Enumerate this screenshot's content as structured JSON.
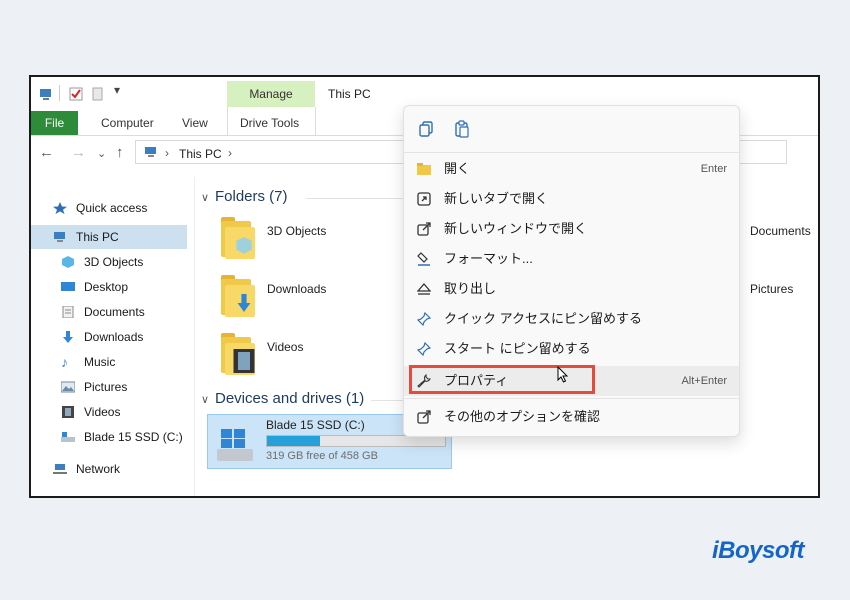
{
  "ribbon": {
    "file_tab": "File",
    "tabs": [
      "Computer",
      "View"
    ],
    "manage_label": "Manage",
    "drive_tools": "Drive Tools",
    "window_title": "This PC"
  },
  "address": {
    "path": "This PC",
    "separator": "›"
  },
  "sidebar": {
    "items": [
      {
        "label": "Quick access",
        "icon": "star-icon"
      },
      {
        "label": "This PC",
        "icon": "computer-icon"
      },
      {
        "label": "3D Objects",
        "icon": "cube-icon"
      },
      {
        "label": "Desktop",
        "icon": "desktop-icon"
      },
      {
        "label": "Documents",
        "icon": "document-icon"
      },
      {
        "label": "Downloads",
        "icon": "download-arrow-icon"
      },
      {
        "label": "Music",
        "icon": "music-note-icon"
      },
      {
        "label": "Pictures",
        "icon": "picture-icon"
      },
      {
        "label": "Videos",
        "icon": "film-icon"
      },
      {
        "label": "Blade 15 SSD (C:)",
        "icon": "drive-icon"
      },
      {
        "label": "Network",
        "icon": "network-icon"
      }
    ]
  },
  "main": {
    "folders_heading": "Folders (7)",
    "folders": [
      "3D Objects",
      "Downloads",
      "Videos",
      "Documents",
      "Pictures"
    ],
    "devices_heading": "Devices and drives (1)",
    "drive": {
      "name": "Blade 15 SSD (C:)",
      "free_text": "319 GB free of 458 GB",
      "used_fraction": 0.3
    }
  },
  "context_menu": {
    "top_icons": [
      "copy-icon",
      "paste-icon"
    ],
    "items": [
      {
        "label": "開く",
        "shortcut": "Enter",
        "icon": "folder-open-icon"
      },
      {
        "label": "新しいタブで開く",
        "shortcut": "",
        "icon": "new-tab-icon"
      },
      {
        "label": "新しいウィンドウで開く",
        "shortcut": "",
        "icon": "new-window-icon"
      },
      {
        "label": "フォーマット...",
        "shortcut": "",
        "icon": "format-icon"
      },
      {
        "label": "取り出し",
        "shortcut": "",
        "icon": "eject-icon"
      },
      {
        "label": "クイック アクセスにピン留めする",
        "shortcut": "",
        "icon": "pin-icon"
      },
      {
        "label": "スタート にピン留めする",
        "shortcut": "",
        "icon": "pin-start-icon"
      },
      {
        "label": "プロパティ",
        "shortcut": "Alt+Enter",
        "icon": "wrench-icon"
      },
      {
        "label": "その他のオプションを確認",
        "shortcut": "",
        "icon": "more-options-icon"
      }
    ]
  },
  "watermark": "iBoysoft",
  "colors": {
    "file_tab": "#2e8b3a",
    "manage_tab": "#d6f0c0",
    "selection": "#cce4f7",
    "progress": "#26a0da",
    "highlight_box": "#e64a3a",
    "brand": "#1565c8"
  }
}
